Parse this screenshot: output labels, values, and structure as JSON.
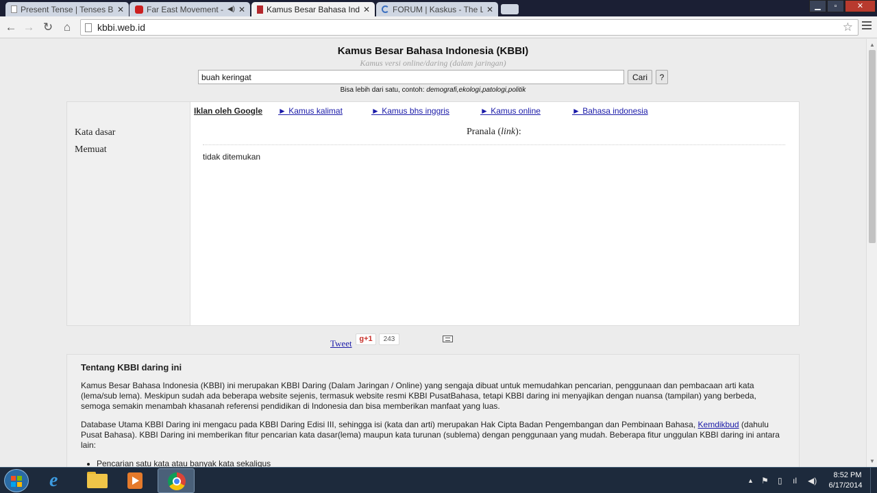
{
  "browser": {
    "tabs": [
      {
        "title": "Present Tense | Tenses Bal",
        "icon": "page-icon",
        "active": false
      },
      {
        "title": "Far East Movement - R",
        "icon": "youtube-icon",
        "active": false
      },
      {
        "title": "Kamus Besar Bahasa Indo",
        "icon": "book-icon",
        "active": true
      },
      {
        "title": "FORUM | Kaskus - The Lar",
        "icon": "loading-icon",
        "active": false
      }
    ],
    "url": "kbbi.web.id"
  },
  "page": {
    "title": "Kamus Besar Bahasa Indonesia (KBBI)",
    "subtitle": "Kamus versi online/daring (dalam jaringan)",
    "search_value": "buah keringat",
    "search_button": "Cari",
    "help_button": "?",
    "hint_prefix": "Bisa lebih dari satu, contoh: ",
    "hint_examples": "demografi,ekologi,patologi,politik",
    "left_labels": [
      "Kata dasar",
      "Memuat"
    ],
    "ad_label": "Iklan oleh Google",
    "ad_links": [
      "► Kamus kalimat",
      "► Kamus bhs inggris",
      "► Kamus online",
      "► Bahasa indonesia"
    ],
    "pranala_prefix": "Pranala (",
    "pranala_link": "link",
    "pranala_suffix": "):",
    "not_found": "tidak ditemukan",
    "social": {
      "tweet": "Tweet",
      "gplus": "g+1",
      "gplus_count": "243"
    },
    "about": {
      "heading": "Tentang KBBI daring ini",
      "p1": "Kamus Besar Bahasa Indonesia (KBBI) ini merupakan KBBI Daring (Dalam Jaringan / Online) yang sengaja dibuat untuk memudahkan pencarian, penggunaan dan pembacaan arti kata (lema/sub lema). Meskipun sudah ada beberapa website sejenis, termasuk website resmi KBBI PusatBahasa, tetapi KBBI daring ini menyajikan dengan nuansa (tampilan) yang berbeda, semoga semakin menambah khasanah referensi pendidikan di Indonesia dan bisa memberikan manfaat yang luas.",
      "p2_before": "Database Utama KBBI Daring ini mengacu pada KBBI Daring Edisi III, sehingga isi (kata dan arti) merupakan Hak Cipta Badan Pengembangan dan Pembinaan Bahasa, ",
      "p2_link": "Kemdikbud",
      "p2_after": " (dahulu Pusat Bahasa). KBBI Daring ini memberikan fitur pencarian kata dasar(lema) maupun kata turunan (sublema) dengan penggunaan yang mudah. Beberapa fitur unggulan KBBI daring ini antara lain:",
      "features": [
        "Pencarian satu kata atau banyak kata sekaligus"
      ]
    }
  },
  "taskbar": {
    "time": "8:52 PM",
    "date": "6/17/2014"
  }
}
